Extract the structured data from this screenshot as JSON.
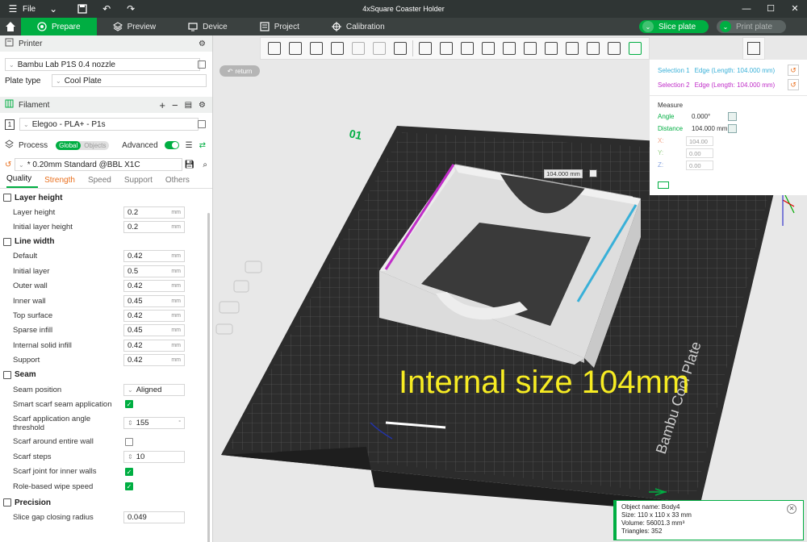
{
  "titlebar": {
    "file_label": "File",
    "title": "4xSquare Coaster Holder"
  },
  "tabs": [
    {
      "label": "Prepare",
      "active": true
    },
    {
      "label": "Preview"
    },
    {
      "label": "Device"
    },
    {
      "label": "Project"
    },
    {
      "label": "Calibration"
    }
  ],
  "actions": {
    "slice_label": "Slice plate",
    "print_label": "Print plate"
  },
  "printer": {
    "section_label": "Printer",
    "name": "Bambu Lab P1S 0.4 nozzle",
    "plate_type_label": "Plate type",
    "plate_type": "Cool Plate"
  },
  "filament": {
    "section_label": "Filament",
    "slot": "1",
    "name": "Elegoo - PLA+ - P1s"
  },
  "process": {
    "section_label": "Process",
    "global_label": "Global",
    "objects_label": "Objects",
    "advanced_label": "Advanced",
    "preset": "* 0.20mm Standard @BBL X1C"
  },
  "setting_tabs": {
    "quality": "Quality",
    "strength": "Strength",
    "speed": "Speed",
    "support": "Support",
    "others": "Others"
  },
  "groups": {
    "layer_height": {
      "title": "Layer height",
      "rows": [
        {
          "label": "Layer height",
          "value": "0.2",
          "unit": "mm"
        },
        {
          "label": "Initial layer height",
          "value": "0.2",
          "unit": "mm"
        }
      ]
    },
    "line_width": {
      "title": "Line width",
      "rows": [
        {
          "label": "Default",
          "value": "0.42",
          "unit": "mm"
        },
        {
          "label": "Initial layer",
          "value": "0.5",
          "unit": "mm"
        },
        {
          "label": "Outer wall",
          "value": "0.42",
          "unit": "mm"
        },
        {
          "label": "Inner wall",
          "value": "0.45",
          "unit": "mm"
        },
        {
          "label": "Top surface",
          "value": "0.42",
          "unit": "mm"
        },
        {
          "label": "Sparse infill",
          "value": "0.45",
          "unit": "mm"
        },
        {
          "label": "Internal solid infill",
          "value": "0.42",
          "unit": "mm"
        },
        {
          "label": "Support",
          "value": "0.42",
          "unit": "mm"
        }
      ]
    },
    "seam": {
      "title": "Seam",
      "seam_position_label": "Seam position",
      "seam_position": "Aligned",
      "smart_scarf_label": "Smart scarf seam application",
      "scarf_angle_label": "Scarf application angle threshold",
      "scarf_angle": "155",
      "scarf_angle_unit": "°",
      "scarf_entire_label": "Scarf around entire wall",
      "scarf_steps_label": "Scarf steps",
      "scarf_steps": "10",
      "scarf_inner_label": "Scarf joint for inner walls",
      "role_wipe_label": "Role-based wipe speed"
    },
    "precision": {
      "title": "Precision",
      "slice_gap_label": "Slice gap closing radius",
      "slice_gap": "0.049"
    }
  },
  "viewport": {
    "return_label": "return",
    "plate_number": "01",
    "plate_brand": "Bambu Cool Plate",
    "dimension_label": "104.000 mm",
    "overlay_text": "Internal size 104mm"
  },
  "measure": {
    "selection1_label": "Selection 1",
    "selection1_value": "Edge (Length: 104.000 mm)",
    "selection2_label": "Selection 2",
    "selection2_value": "Edge (Length: 104.000 mm)",
    "title": "Measure",
    "angle_label": "Angle",
    "angle_value": "0.000°",
    "distance_label": "Distance",
    "distance_value": "104.000 mm",
    "x_label": "X:",
    "x_value": "104.00",
    "y_label": "Y:",
    "y_value": "0.00",
    "z_label": "Z:",
    "z_value": "0.00"
  },
  "object_info": {
    "name": "Object name: Body4",
    "size": "Size: 110 x 110 x 33 mm",
    "volume": "Volume: 56001.3 mm³",
    "triangles": "Triangles: 352"
  },
  "colors": {
    "accent": "#00ae42",
    "selection1": "#39b0d8",
    "selection2": "#c02ec8",
    "overlay_text": "#f7ec23"
  }
}
